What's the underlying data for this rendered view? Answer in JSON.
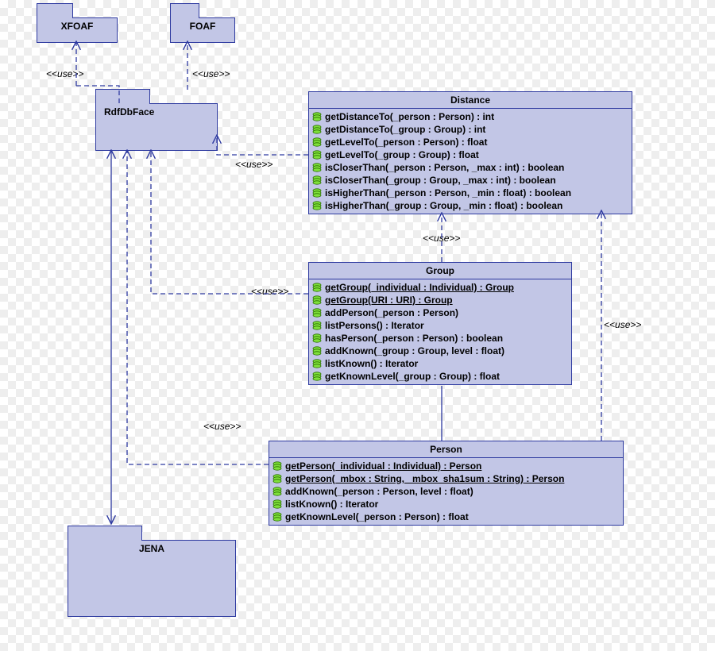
{
  "stereotype_use": "<<use>>",
  "packages": {
    "xfoaf": "XFOAF",
    "foaf": "FOAF",
    "rdfdbface": "RdfDbFace",
    "jena": "JENA"
  },
  "classes": {
    "distance": {
      "name": "Distance",
      "ops": [
        {
          "sig": "getDistanceTo(_person : Person) : int",
          "static": false
        },
        {
          "sig": "getDistanceTo(_group : Group) : int",
          "static": false
        },
        {
          "sig": "getLevelTo(_person : Person) : float",
          "static": false
        },
        {
          "sig": "getLevelTo(_group : Group) : float",
          "static": false
        },
        {
          "sig": "isCloserThan(_person : Person, _max : int) : boolean",
          "static": false
        },
        {
          "sig": "isCloserThan(_group : Group, _max : int) : boolean",
          "static": false
        },
        {
          "sig": "isHigherThan(_person : Person, _min : float) : boolean",
          "static": false
        },
        {
          "sig": "isHigherThan(_group : Group, _min : float) : boolean",
          "static": false
        }
      ]
    },
    "group": {
      "name": "Group",
      "ops": [
        {
          "sig": "getGroup(_individual : Individual) : Group",
          "static": true
        },
        {
          "sig": "getGroup(URI : URI) : Group",
          "static": true
        },
        {
          "sig": "addPerson(_person : Person)",
          "static": false
        },
        {
          "sig": "listPersons() : Iterator",
          "static": false
        },
        {
          "sig": "hasPerson(_person : Person) : boolean",
          "static": false
        },
        {
          "sig": "addKnown(_group : Group, level : float)",
          "static": false
        },
        {
          "sig": "listKnown() : Iterator",
          "static": false
        },
        {
          "sig": "getKnownLevel(_group : Group) : float",
          "static": false
        }
      ]
    },
    "person": {
      "name": "Person",
      "ops": [
        {
          "sig": "getPerson(_individual : Individual) : Person",
          "static": true
        },
        {
          "sig": "getPerson(_mbox : String, _mbox_sha1sum : String) : Person",
          "static": true
        },
        {
          "sig": "addKnown(_person : Person, level : float)",
          "static": false
        },
        {
          "sig": "listKnown() : Iterator",
          "static": false
        },
        {
          "sig": "getKnownLevel(_person : Person) : float",
          "static": false
        }
      ]
    }
  },
  "edges": [
    {
      "from": "RdfDbFace",
      "to": "XFOAF",
      "label": "<<use>>",
      "kind": "dependency"
    },
    {
      "from": "RdfDbFace",
      "to": "FOAF",
      "label": "<<use>>",
      "kind": "dependency"
    },
    {
      "from": "Distance",
      "to": "RdfDbFace",
      "label": "<<use>>",
      "kind": "dependency"
    },
    {
      "from": "Group",
      "to": "RdfDbFace",
      "label": "<<use>>",
      "kind": "dependency"
    },
    {
      "from": "Person",
      "to": "RdfDbFace",
      "label": "<<use>>",
      "kind": "dependency"
    },
    {
      "from": "Group",
      "to": "Distance",
      "label": "<<use>>",
      "kind": "dependency"
    },
    {
      "from": "Person",
      "to": "Distance",
      "label": "<<use>>",
      "kind": "dependency"
    },
    {
      "from": "RdfDbFace",
      "to": "JENA",
      "kind": "association"
    },
    {
      "from": "Person",
      "to": "Group",
      "kind": "association"
    }
  ]
}
